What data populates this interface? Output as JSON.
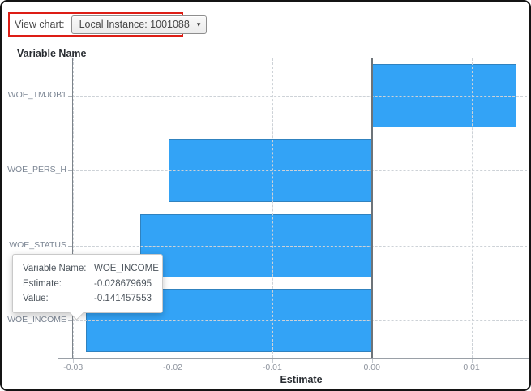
{
  "controls": {
    "view_chart_label": "View chart:",
    "dropdown": {
      "value": "Local Instance: 1001088",
      "caret_icon": "▾"
    },
    "highlight_color": "#dd1d15"
  },
  "chart": {
    "title": "Variable Name",
    "xlabel": "Estimate"
  },
  "chart_data": {
    "type": "bar",
    "orientation": "horizontal",
    "title": "Variable Name",
    "xlabel": "Estimate",
    "ylabel": "Variable Name",
    "categories": [
      "WOE_TMJOB1",
      "WOE_PERS_H",
      "WOE_STATUS",
      "WOE_INCOME"
    ],
    "values": [
      0.0145,
      -0.0204,
      -0.0233,
      -0.028679695
    ],
    "xlim": [
      -0.0301,
      0.0159
    ],
    "xticks": [
      {
        "value": -0.03,
        "label": "-0.03"
      },
      {
        "value": -0.02,
        "label": "-0.02"
      },
      {
        "value": -0.01,
        "label": "-0.01"
      },
      {
        "value": 0.0,
        "label": "0.00"
      },
      {
        "value": 0.01,
        "label": "0.01"
      }
    ],
    "bar_color": "#33a3f6",
    "grid": true,
    "legend": false
  },
  "tooltip": {
    "rows": [
      {
        "label": "Variable Name:",
        "value": "WOE_INCOME"
      },
      {
        "label": "Estimate:",
        "value": "-0.028679695"
      },
      {
        "label": "Value:",
        "value": "-0.141457553"
      }
    ]
  }
}
